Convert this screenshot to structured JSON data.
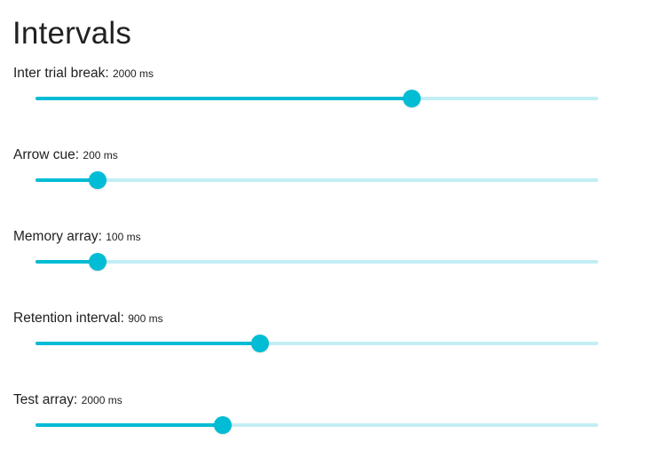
{
  "page": {
    "title": "Intervals"
  },
  "settings": [
    {
      "label": "Inter trial break:",
      "value": "2000 ms",
      "fraction": 0.668
    },
    {
      "label": "Arrow cue:",
      "value": "200 ms",
      "fraction": 0.11
    },
    {
      "label": "Memory array:",
      "value": "100 ms",
      "fraction": 0.11
    },
    {
      "label": "Retention interval:",
      "value": "900 ms",
      "fraction": 0.399
    },
    {
      "label": "Test array:",
      "value": "2000 ms",
      "fraction": 0.333
    }
  ],
  "colors": {
    "accent": "#00bcd4",
    "rail": "#c2eef4",
    "text": "#212121"
  }
}
